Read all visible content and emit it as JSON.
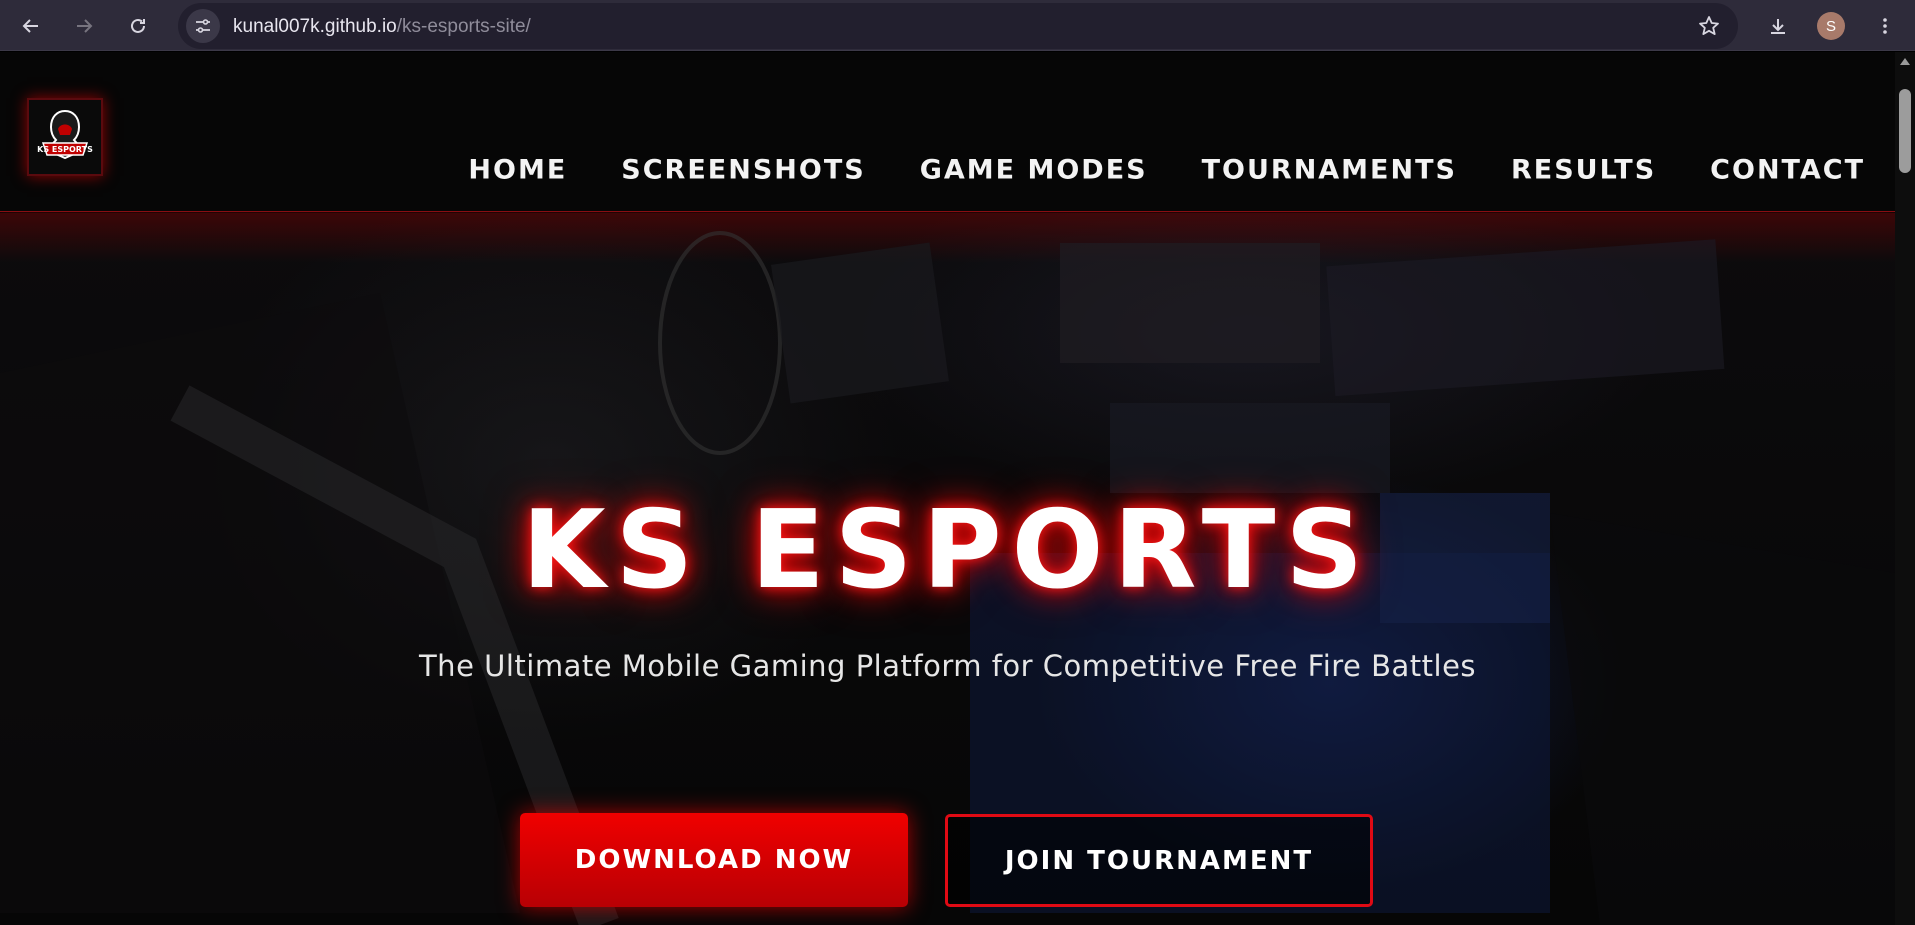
{
  "browser": {
    "url_host": "kunal007k.github.io",
    "url_path": "/ks-esports-site/",
    "avatar_letter": "S",
    "icons": [
      "back-icon",
      "forward-icon",
      "reload-icon",
      "site-info-icon",
      "star-icon",
      "download-icon",
      "menu-icon"
    ]
  },
  "site": {
    "logo_text": "KS ESPORTS",
    "nav": [
      "HOME",
      "SCREENSHOTS",
      "GAME MODES",
      "TOURNAMENTS",
      "RESULTS",
      "CONTACT"
    ]
  },
  "hero": {
    "title": "KS ESPORTS",
    "subtitle": "The Ultimate Mobile Gaming Platform for Competitive Free Fire Battles",
    "primary_button": "DOWNLOAD NOW",
    "secondary_button": "JOIN TOURNAMENT"
  },
  "colors": {
    "accent": "#e00a14",
    "chrome": "#2e2b3a",
    "background": "#050505"
  }
}
